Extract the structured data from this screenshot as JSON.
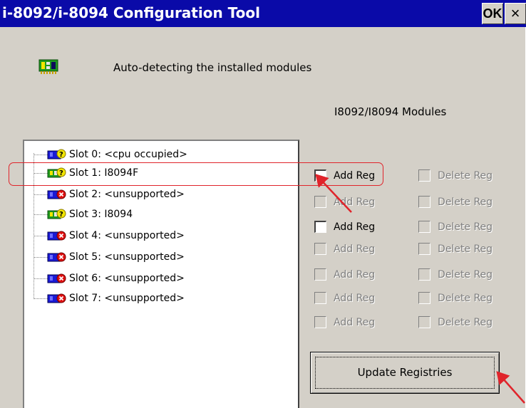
{
  "window": {
    "title": "i-8092/i-8094 Configuration Tool",
    "ok_label": "OK",
    "close_label": "×"
  },
  "status_text": "Auto-detecting the installed modules",
  "modules_label": "I8092/I8094 Modules",
  "slots": [
    {
      "label": "Slot 0: <cpu occupied>",
      "icon": "cpu-slot-icon"
    },
    {
      "label": "Slot 1: I8094F",
      "icon": "motion-module-icon"
    },
    {
      "label": "Slot 2: <unsupported>",
      "icon": "unsupported-module-icon"
    },
    {
      "label": "Slot 3: I8094",
      "icon": "motion-module-icon"
    },
    {
      "label": "Slot 4: <unsupported>",
      "icon": "unsupported-module-icon"
    },
    {
      "label": "Slot 5: <unsupported>",
      "icon": "unsupported-module-icon"
    },
    {
      "label": "Slot 6: <unsupported>",
      "icon": "unsupported-module-icon"
    },
    {
      "label": "Slot 7: <unsupported>",
      "icon": "unsupported-module-icon"
    }
  ],
  "reg_rows": [
    {
      "add": {
        "label": "Add Reg",
        "enabled": true
      },
      "del": {
        "label": "Delete Reg",
        "enabled": false
      }
    },
    {
      "add": {
        "label": "Add Reg",
        "enabled": false
      },
      "del": {
        "label": "Delete Reg",
        "enabled": false
      }
    },
    {
      "add": {
        "label": "Add Reg",
        "enabled": true
      },
      "del": {
        "label": "Delete Reg",
        "enabled": false
      }
    },
    {
      "add": {
        "label": "Add Reg",
        "enabled": false
      },
      "del": {
        "label": "Delete Reg",
        "enabled": false
      }
    },
    {
      "add": {
        "label": "Add Reg",
        "enabled": false
      },
      "del": {
        "label": "Delete Reg",
        "enabled": false
      }
    },
    {
      "add": {
        "label": "Add Reg",
        "enabled": false
      },
      "del": {
        "label": "Delete Reg",
        "enabled": false
      }
    },
    {
      "add": {
        "label": "Add Reg",
        "enabled": false
      },
      "del": {
        "label": "Delete Reg",
        "enabled": false
      }
    }
  ],
  "update_button_label": "Update Registries",
  "colors": {
    "titlebar": "#0a0aa8",
    "dialog_face": "#d4d0c8",
    "annotation": "#e0242b"
  }
}
